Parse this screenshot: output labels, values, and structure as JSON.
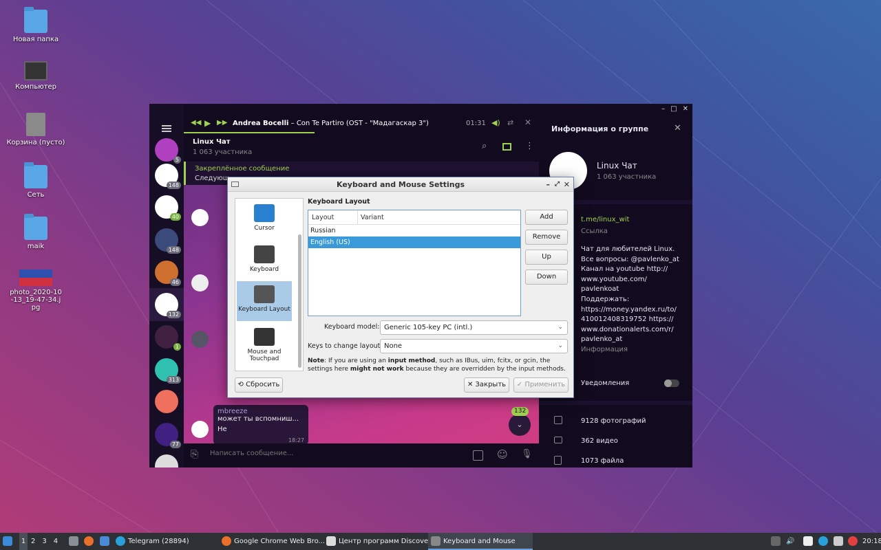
{
  "desktop": {
    "icons": [
      {
        "label": "Новая папка"
      },
      {
        "label": "Компьютер"
      },
      {
        "label": "Корзина (пусто)"
      },
      {
        "label": "Сеть"
      },
      {
        "label": "maik"
      },
      {
        "label": "photo_2020-10-13_19-47-34.jpg"
      }
    ]
  },
  "telegram": {
    "player": {
      "track": "Andrea Bocelli",
      "title": "Con Te Partiro (OST - \"Мадагаскар 3\")",
      "separator": " – ",
      "time": "01:31"
    },
    "chat": {
      "name": "Linux Чат",
      "members": "1 063 участника",
      "pinned_title": "Закреплённое сообщение",
      "pinned_text": "Следующ...",
      "input_placeholder": "Написать сообщение...",
      "last_sender": "mbreeze",
      "last_text": "может ты вспомниш...",
      "reply": "Не",
      "reply_time": "18:27",
      "unread": "132"
    },
    "sidebar_counts": [
      "5",
      "148",
      "40",
      "148",
      "46",
      "132",
      "1",
      "313",
      "77"
    ],
    "info": {
      "header": "Информация о группе",
      "name": "Linux Чат",
      "members": "1 063 участника",
      "link": "t.me/linux_wit",
      "link_label": "Ссылка",
      "desc_lines": [
        "Чат для любителей Linux.",
        "Все вопросы: @pavlenko_at",
        "Канал на youtube http://",
        "www.youtube.com/",
        "pavlenkoat",
        "Поддержать:",
        "https://money.yandex.ru/to/",
        "410012408319752 https://",
        "www.donationalerts.com/r/",
        "pavlenko_at"
      ],
      "desc_label": "Информация",
      "notifications": "Уведомления",
      "photos": "9128 фотографий",
      "videos": "362 видео",
      "files": "1073 файла"
    }
  },
  "dialog": {
    "title": "Keyboard and Mouse Settings",
    "categories": [
      {
        "label": "Cursor"
      },
      {
        "label": "Keyboard"
      },
      {
        "label": "Keyboard Layout"
      },
      {
        "label": "Mouse and Touchpad"
      }
    ],
    "section": "Keyboard Layout",
    "columns": [
      "Layout",
      "Variant"
    ],
    "layouts": [
      {
        "layout": "Russian",
        "variant": ""
      },
      {
        "layout": "English (US)",
        "variant": ""
      }
    ],
    "buttons": {
      "add": "Add",
      "remove": "Remove",
      "up": "Up",
      "down": "Down",
      "reset": "Сбросить",
      "close": "Закрыть",
      "apply": "Применить"
    },
    "model_label": "Keyboard model:",
    "model_value": "Generic 105-key PC (intl.)",
    "keys_label": "Keys to change layout:",
    "keys_value": "None",
    "note_prefix": "Note",
    "note_1": ": If you are using an ",
    "note_b1": "input method",
    "note_2": ", such as IBus, uim, fcitx, or gcin, the settings here ",
    "note_b2": "might not work",
    "note_3": " because they are overridden by the input methods."
  },
  "taskbar": {
    "workspaces": [
      "1",
      "2",
      "3",
      "4"
    ],
    "tasks": [
      {
        "label": "Telegram (28894)"
      },
      {
        "label": "Google Chrome Web Bro..."
      },
      {
        "label": "Центр программ Discover"
      },
      {
        "label": "Keyboard and Mouse Sett..."
      }
    ],
    "clock": "20:18"
  },
  "colors": {
    "accent": "#a0d250",
    "selection": "#3a9ad9",
    "tg_bg": "#120b1f"
  }
}
